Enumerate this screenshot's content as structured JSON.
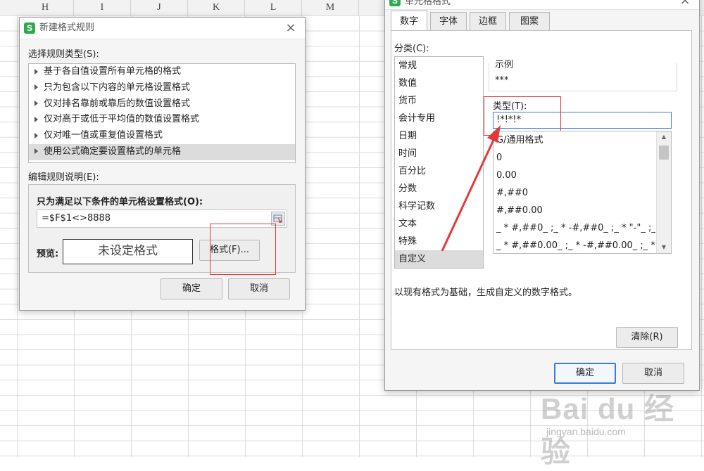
{
  "spreadsheet": {
    "columns": [
      "H",
      "I",
      "J",
      "K",
      "L",
      "M"
    ]
  },
  "left_dialog": {
    "title": "新建格式规则",
    "close_glyph": "×",
    "select_type_label": "选择规则类型(S):",
    "rule_types": [
      "基于各自值设置所有单元格的格式",
      "只为包含以下内容的单元格设置格式",
      "仅对排名靠前或靠后的数值设置格式",
      "仅对高于或低于平均值的数值设置格式",
      "仅对唯一值或重复值设置格式",
      "使用公式确定要设置格式的单元格"
    ],
    "edit_desc_label": "编辑规则说明(E):",
    "condition_label": "只为满足以下条件的单元格设置格式(O):",
    "formula_value": "=$F$1<>8888",
    "preview_label": "预览:",
    "preview_text": "未设定格式",
    "format_button": "格式(F)...",
    "ok_button": "确定",
    "cancel_button": "取消"
  },
  "right_dialog": {
    "title": "单元格格式",
    "close_glyph": "×",
    "tabs": [
      "数字",
      "字体",
      "边框",
      "图案"
    ],
    "category_label": "分类(C):",
    "categories": [
      "常规",
      "数值",
      "货币",
      "会计专用",
      "日期",
      "时间",
      "百分比",
      "分数",
      "科学记数",
      "文本",
      "特殊",
      "自定义"
    ],
    "sample_label": "示例",
    "sample_value": "***",
    "type_label": "类型(T):",
    "type_value": "!*!*!*",
    "formats": [
      "G/通用格式",
      "0",
      "0.00",
      "#,##0",
      "#,##0.00",
      "_ * #,##0_ ;_ * -#,##0_ ;_ * \"-\"_ ;_...",
      "_ * #,##0.00_ ;_ * -#,##0.00_ ;_ *..."
    ],
    "description": "以现有格式为基础，生成自定义的数字格式。",
    "clear_button": "清除(R)",
    "ok_button": "确定",
    "cancel_button": "取消"
  },
  "watermark": {
    "logo": "Bai du 经验",
    "sub": "jingyan.baidu.com"
  },
  "colors": {
    "annotation_red": "#e33a3a",
    "accent_blue": "#3c7bd6",
    "app_green": "#2fa84f"
  }
}
